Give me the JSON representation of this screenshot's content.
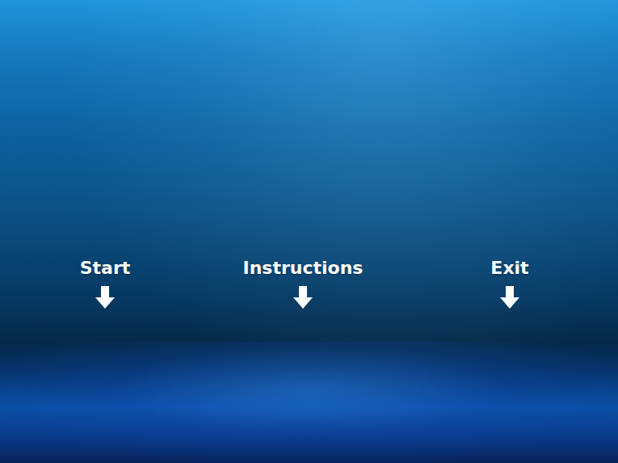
{
  "menu": {
    "items": [
      {
        "label": "Start"
      },
      {
        "label": "Instructions"
      },
      {
        "label": "Exit"
      }
    ]
  }
}
